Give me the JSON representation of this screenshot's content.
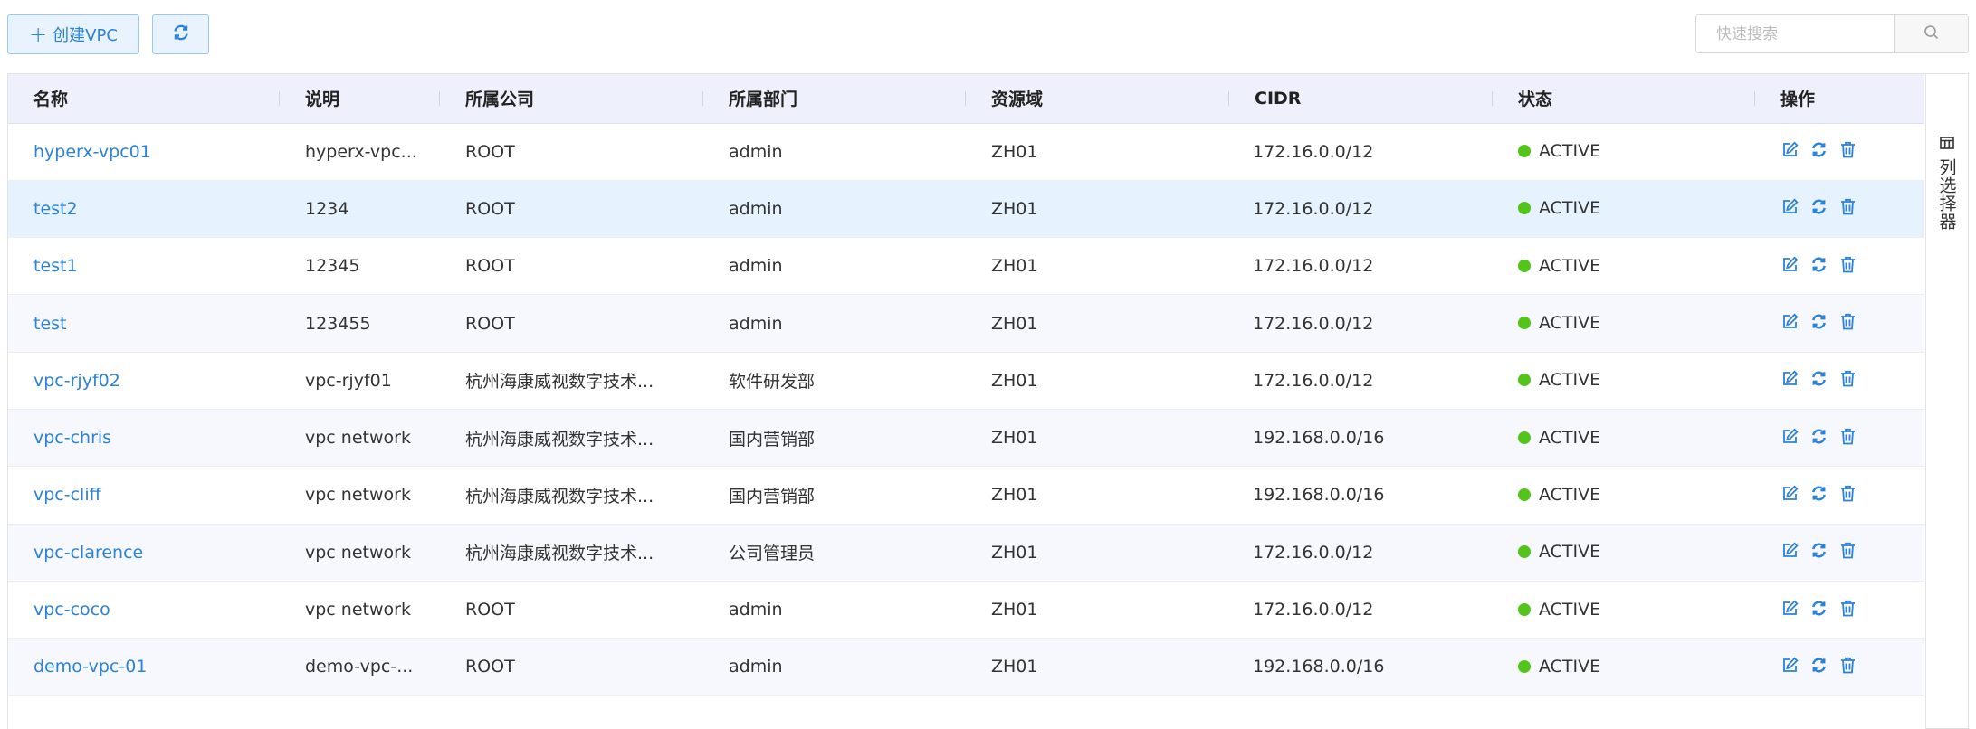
{
  "toolbar": {
    "create_label": "创建VPC",
    "create_icon": "plus-icon",
    "refresh_icon": "refresh-icon"
  },
  "search": {
    "placeholder": "快速搜索",
    "value": "",
    "icon": "search-icon"
  },
  "colors": {
    "accent": "#2b82d9",
    "active": "#52c41a",
    "header_bg": "#eef0fb",
    "selected_row_bg": "#e6f2fd"
  },
  "table": {
    "columns": [
      "名称",
      "说明",
      "所属公司",
      "所属部门",
      "资源域",
      "CIDR",
      "状态",
      "操作"
    ],
    "row_action_icons": [
      "edit-icon",
      "refresh-icon",
      "delete-icon"
    ],
    "rows": [
      {
        "name": "hyperx-vpc01",
        "desc": "hyperx-vpc...",
        "company": "ROOT",
        "dept": "admin",
        "region": "ZH01",
        "cidr": "172.16.0.0/12",
        "status": "ACTIVE"
      },
      {
        "name": "test2",
        "desc": "1234",
        "company": "ROOT",
        "dept": "admin",
        "region": "ZH01",
        "cidr": "172.16.0.0/12",
        "status": "ACTIVE"
      },
      {
        "name": "test1",
        "desc": "12345",
        "company": "ROOT",
        "dept": "admin",
        "region": "ZH01",
        "cidr": "172.16.0.0/12",
        "status": "ACTIVE"
      },
      {
        "name": "test",
        "desc": "123455",
        "company": "ROOT",
        "dept": "admin",
        "region": "ZH01",
        "cidr": "172.16.0.0/12",
        "status": "ACTIVE"
      },
      {
        "name": "vpc-rjyf02",
        "desc": "vpc-rjyf01",
        "company": "杭州海康威视数字技术...",
        "dept": "软件研发部",
        "region": "ZH01",
        "cidr": "172.16.0.0/12",
        "status": "ACTIVE"
      },
      {
        "name": "vpc-chris",
        "desc": "vpc network",
        "company": "杭州海康威视数字技术...",
        "dept": "国内营销部",
        "region": "ZH01",
        "cidr": "192.168.0.0/16",
        "status": "ACTIVE"
      },
      {
        "name": "vpc-cliff",
        "desc": "vpc network",
        "company": "杭州海康威视数字技术...",
        "dept": "国内营销部",
        "region": "ZH01",
        "cidr": "192.168.0.0/16",
        "status": "ACTIVE"
      },
      {
        "name": "vpc-clarence",
        "desc": "vpc network",
        "company": "杭州海康威视数字技术...",
        "dept": "公司管理员",
        "region": "ZH01",
        "cidr": "172.16.0.0/12",
        "status": "ACTIVE"
      },
      {
        "name": "vpc-coco",
        "desc": "vpc network",
        "company": "ROOT",
        "dept": "admin",
        "region": "ZH01",
        "cidr": "172.16.0.0/12",
        "status": "ACTIVE"
      },
      {
        "name": "demo-vpc-01",
        "desc": "demo-vpc-...",
        "company": "ROOT",
        "dept": "admin",
        "region": "ZH01",
        "cidr": "192.168.0.0/16",
        "status": "ACTIVE"
      }
    ],
    "selected_row": 1
  },
  "column_picker": {
    "label": "列选择器",
    "icon": "columns-icon"
  }
}
